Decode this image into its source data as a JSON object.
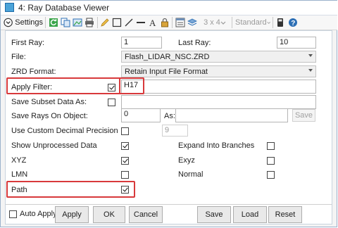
{
  "window": {
    "title": "4: Ray Database Viewer"
  },
  "toolbar": {
    "settings_label": "Settings",
    "layout_label": "3 x 4",
    "style_label": "Standard"
  },
  "form": {
    "first_ray_label": "First Ray:",
    "first_ray_value": "1",
    "last_ray_label": "Last Ray:",
    "last_ray_value": "10",
    "file_label": "File:",
    "file_value": "Flash_LIDAR_NSC.ZRD",
    "zrd_format_label": "ZRD Format:",
    "zrd_format_value": "Retain Input File Format",
    "apply_filter_label": "Apply Filter:",
    "apply_filter_value": "H17",
    "save_subset_label": "Save Subset Data As:",
    "save_subset_value": "",
    "save_rays_label": "Save Rays On Object:",
    "save_rays_value": "0",
    "as_label": "As:",
    "as_value": "",
    "save_small_label": "Save",
    "custom_precision_label": "Use Custom Decimal Precision",
    "custom_precision_value": "9",
    "show_unprocessed_label": "Show Unprocessed Data",
    "expand_branches_label": "Expand Into Branches",
    "xyz_label": "XYZ",
    "exyz_label": "Exyz",
    "lmn_label": "LMN",
    "normal_label": "Normal",
    "path_label": "Path"
  },
  "checks": {
    "apply_filter": true,
    "save_subset": false,
    "custom_precision": false,
    "show_unprocessed": true,
    "expand_branches": false,
    "xyz": true,
    "exyz": false,
    "lmn": false,
    "normal": false,
    "path": true,
    "auto_apply": false
  },
  "buttons": {
    "auto_apply_label": "Auto Apply",
    "apply": "Apply",
    "ok": "OK",
    "cancel": "Cancel",
    "save": "Save",
    "load": "Load",
    "reset": "Reset"
  },
  "colors": {
    "highlight": "#d8393b",
    "accent": "#1e6aa6"
  }
}
